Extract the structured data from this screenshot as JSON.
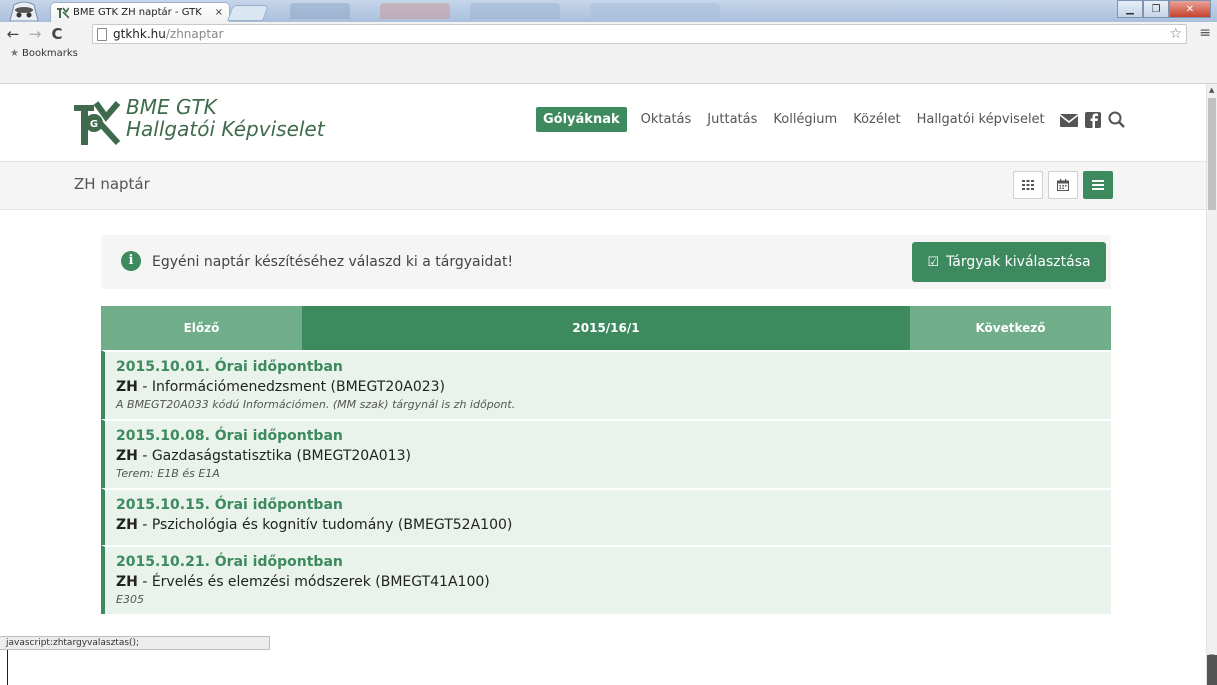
{
  "browser": {
    "tab_title": "BME GTK ZH naptár - GTK",
    "tab_close": "×",
    "url_host": "gtkhk.hu",
    "url_path": "/zhnaptar",
    "bookmarks_label": "Bookmarks",
    "status_text": "javascript:zhtargyvalasztas();"
  },
  "site": {
    "logo_line1": "BME GTK",
    "logo_line2": "Hallgatói Képviselet",
    "nav": [
      "Gólyáknak",
      "Oktatás",
      "Juttatás",
      "Kollégium",
      "Közélet",
      "Hallgatói képviselet"
    ]
  },
  "page": {
    "title": "ZH naptár",
    "info_text": "Egyéni naptár készítéséhez válaszd ki a tárgyaidat!",
    "select_button": "Tárgyak kiválasztása",
    "prev": "Előző",
    "current": "2015/16/1",
    "next": "Következő"
  },
  "events": [
    {
      "date": "2015.10.01. Órai időpontban",
      "type": "ZH",
      "subject": " - Információmenedzsment (BMEGT20A023)",
      "note": "A BMEGT20A033 kódú Információmen. (MM szak) tárgynál is zh időpont."
    },
    {
      "date": "2015.10.08. Órai időpontban",
      "type": "ZH",
      "subject": " - Gazdaságstatisztika (BMEGT20A013)",
      "note": "Terem: E1B és E1A"
    },
    {
      "date": "2015.10.15. Órai időpontban",
      "type": "ZH",
      "subject": " - Pszichológia és kognitív tudomány (BMEGT52A100)",
      "note": ""
    },
    {
      "date": "2015.10.21. Órai időpontban",
      "type": "ZH",
      "subject": " - Érvelés és elemzési módszerek (BMEGT41A100)",
      "note": "E305"
    }
  ],
  "colors": {
    "brand_green": "#3d8a5f",
    "light_green": "#6fae88",
    "event_bg": "#e9f3ec"
  }
}
